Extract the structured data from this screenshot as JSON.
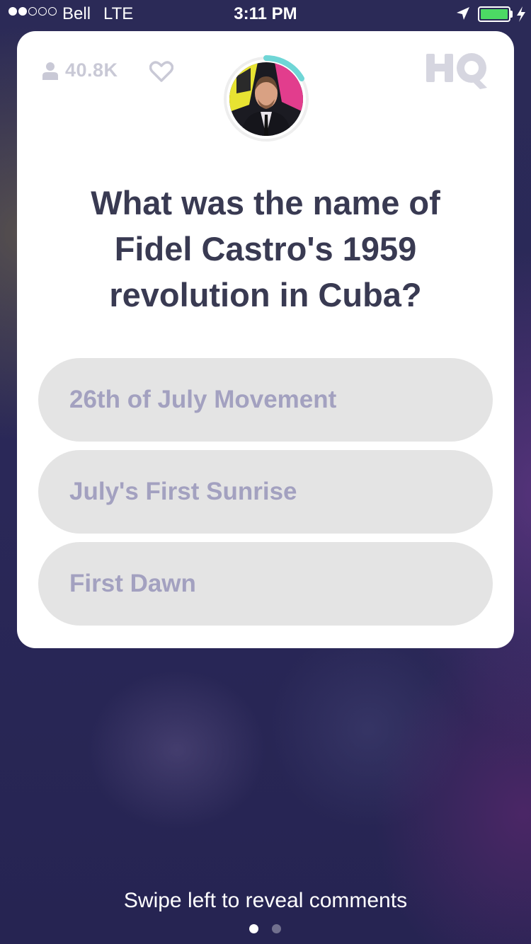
{
  "status_bar": {
    "carrier": "Bell",
    "network": "LTE",
    "time": "3:11 PM",
    "signal_bars_filled": 2,
    "signal_bars_total": 5,
    "battery_color": "#4cd964"
  },
  "header": {
    "viewer_count": "40.8K",
    "viewer_icon": "person-icon",
    "like_icon": "heart-icon",
    "logo": "HQ"
  },
  "question": {
    "text": "What was the name of Fidel Castro's 1959 revolution in Cuba?"
  },
  "answers": [
    {
      "label": "26th of July Movement"
    },
    {
      "label": "July's First Sunrise"
    },
    {
      "label": "First Dawn"
    }
  ],
  "footer": {
    "swipe_hint": "Swipe left to reveal comments",
    "pages_total": 2,
    "active_page": 1
  },
  "colors": {
    "accent": "#6fd6d6",
    "answer_bg": "#e4e4e4",
    "answer_text": "#a3a1c0",
    "question_text": "#393a52"
  }
}
